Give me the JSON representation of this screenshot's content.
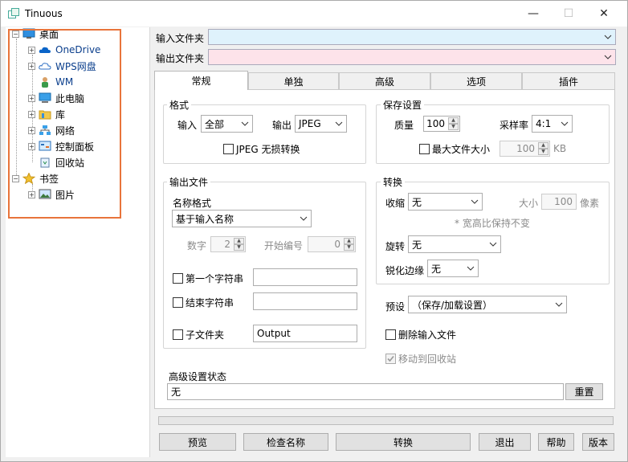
{
  "window": {
    "title": "Tinuous",
    "minimize_glyph": "—",
    "maximize_glyph": "☐",
    "close_glyph": "✕"
  },
  "tree": {
    "items": [
      {
        "label": "桌面",
        "icon": "desktop-icon",
        "expander": "−"
      },
      {
        "label": "OneDrive",
        "icon": "onedrive-cloud-icon",
        "expander": "+"
      },
      {
        "label": "WPS网盘",
        "icon": "wps-cloud-icon",
        "expander": "+"
      },
      {
        "label": "WM",
        "icon": "user-icon",
        "expander": ""
      },
      {
        "label": "此电脑",
        "icon": "computer-icon",
        "expander": "+"
      },
      {
        "label": "库",
        "icon": "library-folder-icon",
        "expander": "+"
      },
      {
        "label": "网络",
        "icon": "network-icon",
        "expander": "+"
      },
      {
        "label": "控制面板",
        "icon": "control-panel-icon",
        "expander": "+"
      },
      {
        "label": "回收站",
        "icon": "recycle-bin-icon",
        "expander": ""
      },
      {
        "label": "书签",
        "icon": "star-icon",
        "expander": "−"
      },
      {
        "label": "图片",
        "icon": "pictures-icon",
        "expander": "+"
      }
    ]
  },
  "input_folder": {
    "label": "输入文件夹",
    "value": ""
  },
  "output_folder": {
    "label": "输出文件夹",
    "value": ""
  },
  "tabs": [
    "常规",
    "单独",
    "高级",
    "选项",
    "插件"
  ],
  "format": {
    "title": "格式",
    "input_label": "输入",
    "input_value": "全部",
    "output_label": "输出",
    "output_value": "JPEG",
    "lossless_label": "JPEG 无损转换"
  },
  "save": {
    "title": "保存设置",
    "quality_label": "质量",
    "quality_value": "100",
    "sampling_label": "采样率",
    "sampling_value": "4:1",
    "maxsize_label": "最大文件大小",
    "maxsize_value": "100",
    "maxsize_unit": "KB"
  },
  "output_file": {
    "title": "输出文件",
    "name_format_label": "名称格式",
    "name_format_value": "基于输入名称",
    "digits_label": "数字",
    "digits_value": "2",
    "start_label": "开始编号",
    "start_value": "0",
    "first_string_label": "第一个字符串",
    "first_string_value": "",
    "end_string_label": "结束字符串",
    "end_string_value": "",
    "subfolder_label": "子文件夹",
    "subfolder_value": "Output"
  },
  "convert": {
    "title": "转换",
    "shrink_label": "收缩",
    "shrink_value": "无",
    "size_label": "大小",
    "size_value": "100",
    "size_unit": "像素",
    "aspect_note": "* 宽高比保持不变",
    "rotate_label": "旋转",
    "rotate_value": "无",
    "sharpen_label": "锐化边缘",
    "sharpen_value": "无"
  },
  "preset": {
    "label": "预设",
    "value": "（保存/加载设置）"
  },
  "delete_input_label": "删除输入文件",
  "move_recycle_label": "移动到回收站",
  "advanced_status": {
    "label": "高级设置状态",
    "value": "无",
    "reset_label": "重置"
  },
  "progress": 0,
  "buttons": {
    "preview": "预览",
    "check_names": "检查名称",
    "convert": "转换",
    "exit": "退出",
    "help": "帮助",
    "version": "版本"
  }
}
